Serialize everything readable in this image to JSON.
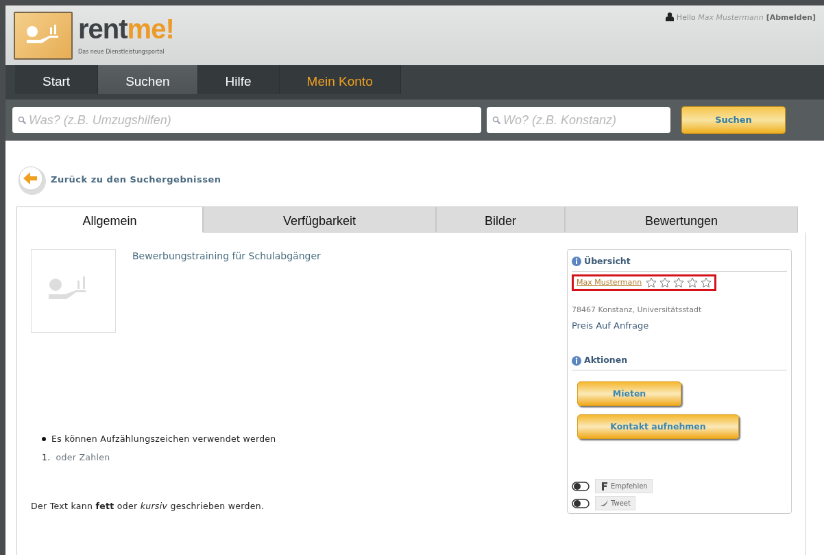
{
  "header": {
    "logo_text": "rent",
    "logo_accent": "me!",
    "tagline": "Das neue Dienstleistungsportal",
    "greeting": "Hello",
    "user_name": "Max Mustermann",
    "logout": "[Abmelden]"
  },
  "nav": [
    {
      "label": "Start",
      "selected": false,
      "kind": "normal"
    },
    {
      "label": "Suchen",
      "selected": true,
      "kind": "normal"
    },
    {
      "label": "Hilfe",
      "selected": false,
      "kind": "normal"
    },
    {
      "label": "Mein Konto",
      "selected": false,
      "kind": "account"
    }
  ],
  "search": {
    "what_placeholder": "Was? (z.B. Umzugshilfen)",
    "where_placeholder": "Wo? (z.B. Konstanz)",
    "button": "Suchen"
  },
  "back_link": "Zurück zu den Suchergebnissen",
  "tabs": [
    {
      "label": "Allgemein",
      "selected": true
    },
    {
      "label": "Verfügbarkeit",
      "selected": false
    },
    {
      "label": "Bilder",
      "selected": false
    },
    {
      "label": "Bewertungen",
      "selected": false
    }
  ],
  "offer": {
    "title": "Bewerbungstraining für Schulabgänger",
    "bullet_items": [
      "Es können Aufzählungszeichen verwendet werden"
    ],
    "numbered_items": [
      {
        "number": "1.",
        "text": "oder Zahlen"
      }
    ],
    "paragraph": "Der Text kann **fett** oder *kursiv* geschrieben werden."
  },
  "overview": {
    "heading": "Übersicht",
    "provider": "Max Mustermann",
    "stars": 0,
    "address": "78467 Konstanz, Universitätsstadt",
    "price": "Preis Auf Anfrage"
  },
  "actions": {
    "heading": "Aktionen",
    "buttons": [
      "Mieten",
      "Kontakt aufnehmen"
    ]
  },
  "social": [
    {
      "label": "Empfehlen",
      "kind": "facebook",
      "on": false
    },
    {
      "label": "Tweet",
      "kind": "twitter",
      "on": false
    }
  ]
}
